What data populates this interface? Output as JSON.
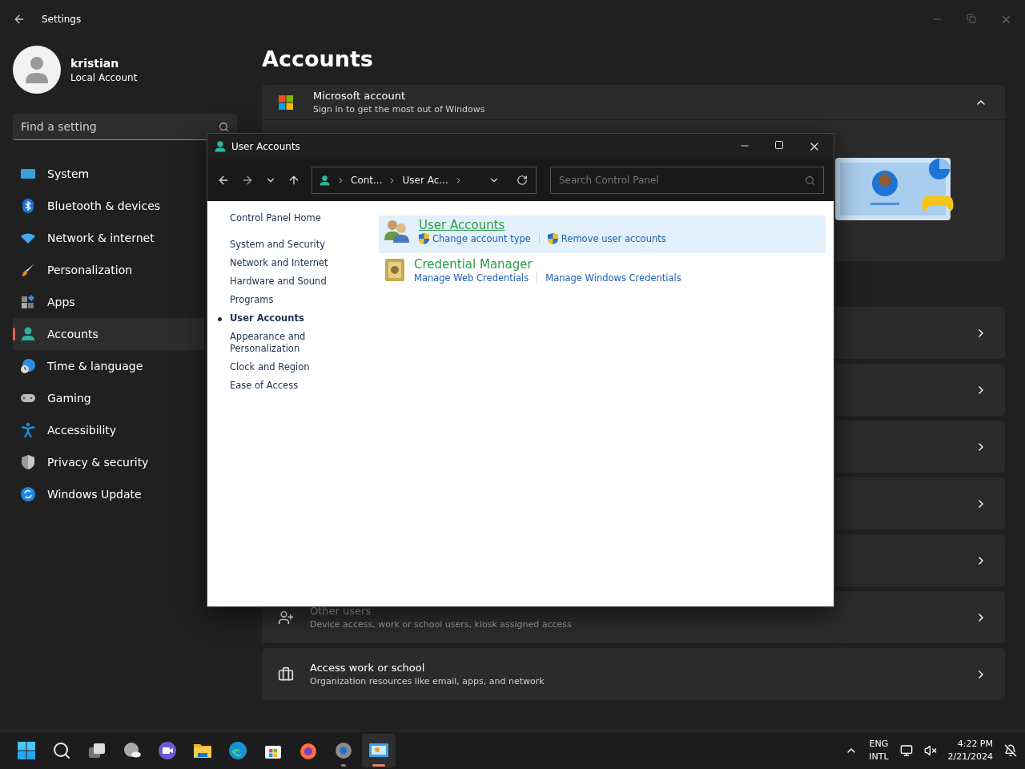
{
  "settings": {
    "title": "Settings",
    "user": {
      "name": "kristian",
      "type": "Local Account"
    },
    "search": {
      "placeholder": "Find a setting"
    },
    "nav": [
      {
        "label": "System",
        "selected": false
      },
      {
        "label": "Bluetooth & devices",
        "selected": false
      },
      {
        "label": "Network & internet",
        "selected": false
      },
      {
        "label": "Personalization",
        "selected": false
      },
      {
        "label": "Apps",
        "selected": false
      },
      {
        "label": "Accounts",
        "selected": true
      },
      {
        "label": "Time & language",
        "selected": false
      },
      {
        "label": "Gaming",
        "selected": false
      },
      {
        "label": "Accessibility",
        "selected": false
      },
      {
        "label": "Privacy & security",
        "selected": false
      },
      {
        "label": "Windows Update",
        "selected": false
      }
    ],
    "page_title": "Accounts",
    "cards": [
      {
        "kind": "expanded",
        "title": "Microsoft account",
        "subtitle": "Sign in to get the most out of Windows"
      },
      {
        "kind": "blank"
      },
      {
        "kind": "blank"
      },
      {
        "kind": "blank"
      },
      {
        "kind": "blank"
      },
      {
        "kind": "blank"
      },
      {
        "kind": "item",
        "title": "Other users",
        "subtitle": "Device access, work or school users, kiosk assigned access",
        "dimmed": true
      },
      {
        "kind": "item",
        "title": "Access work or school",
        "subtitle": "Organization resources like email, apps, and network",
        "dimmed": false
      }
    ]
  },
  "control_panel": {
    "title": "User Accounts",
    "breadcrumb": [
      "Cont...",
      "User Ac..."
    ],
    "search": {
      "placeholder": "Search Control Panel"
    },
    "sidebar": [
      {
        "label": "Control Panel Home",
        "selected": false
      },
      {
        "label": "System and Security",
        "selected": false
      },
      {
        "label": "Network and Internet",
        "selected": false
      },
      {
        "label": "Hardware and Sound",
        "selected": false
      },
      {
        "label": "Programs",
        "selected": false
      },
      {
        "label": "User Accounts",
        "selected": true
      },
      {
        "label": "Appearance and Personalization",
        "selected": false
      },
      {
        "label": "Clock and Region",
        "selected": false
      },
      {
        "label": "Ease of Access",
        "selected": false
      }
    ],
    "categories": [
      {
        "title": "User Accounts",
        "selected": true,
        "links": [
          {
            "label": "Change account type",
            "shield": true
          },
          {
            "label": "Remove user accounts",
            "shield": true
          }
        ]
      },
      {
        "title": "Credential Manager",
        "selected": false,
        "links": [
          {
            "label": "Manage Web Credentials",
            "shield": false
          },
          {
            "label": "Manage Windows Credentials",
            "shield": false
          }
        ]
      }
    ]
  },
  "taskbar": {
    "apps": [
      {
        "running": false,
        "selected": false
      },
      {
        "running": false,
        "selected": false
      },
      {
        "running": false,
        "selected": false
      },
      {
        "running": false,
        "selected": false
      },
      {
        "running": false,
        "selected": false
      },
      {
        "running": false,
        "selected": false
      },
      {
        "running": false,
        "selected": false
      },
      {
        "running": false,
        "selected": false
      },
      {
        "running": false,
        "selected": false
      },
      {
        "running": true,
        "selected": false
      },
      {
        "running": true,
        "selected": true
      }
    ],
    "language": [
      "ENG",
      "INTL"
    ],
    "time": "4:22 PM",
    "date": "2/21/2024"
  }
}
